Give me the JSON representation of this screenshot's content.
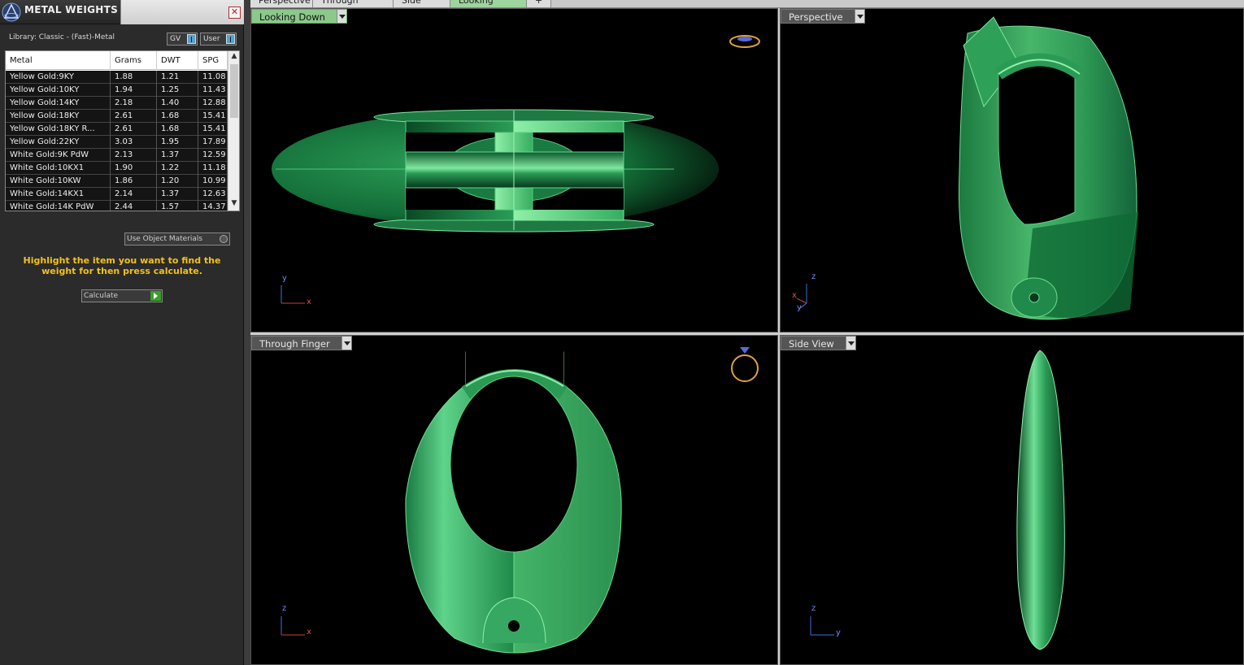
{
  "panel": {
    "title": "METAL WEIGHTS",
    "close_label": "✕",
    "library_label": "Library: Classic - (Fast)-Metal",
    "toggle_gv": "GV",
    "toggle_user": "User",
    "use_materials_label": "Use Object Materials",
    "instructions": "Highlight the item you want to find the weight for then press calculate.",
    "calculate_label": "Calculate"
  },
  "table": {
    "columns": [
      "Metal",
      "Grams",
      "DWT",
      "SPG"
    ],
    "rows": [
      [
        "Yellow Gold:9KY",
        "1.88",
        "1.21",
        "11.08"
      ],
      [
        "Yellow Gold:10KY",
        "1.94",
        "1.25",
        "11.43"
      ],
      [
        "Yellow Gold:14KY",
        "2.18",
        "1.40",
        "12.88"
      ],
      [
        "Yellow Gold:18KY",
        "2.61",
        "1.68",
        "15.41"
      ],
      [
        "Yellow Gold:18KY R...",
        "2.61",
        "1.68",
        "15.41"
      ],
      [
        "Yellow Gold:22KY",
        "3.03",
        "1.95",
        "17.89"
      ],
      [
        "White Gold:9K PdW",
        "2.13",
        "1.37",
        "12.59"
      ],
      [
        "White Gold:10KX1",
        "1.90",
        "1.22",
        "11.18"
      ],
      [
        "White Gold:10KW",
        "1.86",
        "1.20",
        "10.99"
      ],
      [
        "White Gold:14KX1",
        "2.14",
        "1.37",
        "12.63"
      ],
      [
        "White Gold:14K PdW",
        "2.44",
        "1.57",
        "14.37"
      ]
    ]
  },
  "tabs": [
    {
      "label": "Perspective",
      "active": false
    },
    {
      "label": "Through Finger",
      "active": false
    },
    {
      "label": "Side View",
      "active": false
    },
    {
      "label": "Looking Down",
      "active": true
    },
    {
      "label": "+",
      "active": false
    }
  ],
  "viewports": {
    "top_left": {
      "label": "Looking Down",
      "axes": [
        "y",
        "x"
      ]
    },
    "top_right": {
      "label": "Perspective",
      "axes": [
        "z",
        "x",
        "y"
      ]
    },
    "bottom_left": {
      "label": "Through Finger",
      "axes": [
        "z",
        "x"
      ]
    },
    "bottom_right": {
      "label": "Side View",
      "axes": [
        "z",
        "y"
      ]
    }
  },
  "colors": {
    "model_green": "#2f9a55",
    "model_highlight": "#9ff0b0",
    "active_tab": "#9ed49e",
    "instruction_text": "#f2c21a"
  }
}
